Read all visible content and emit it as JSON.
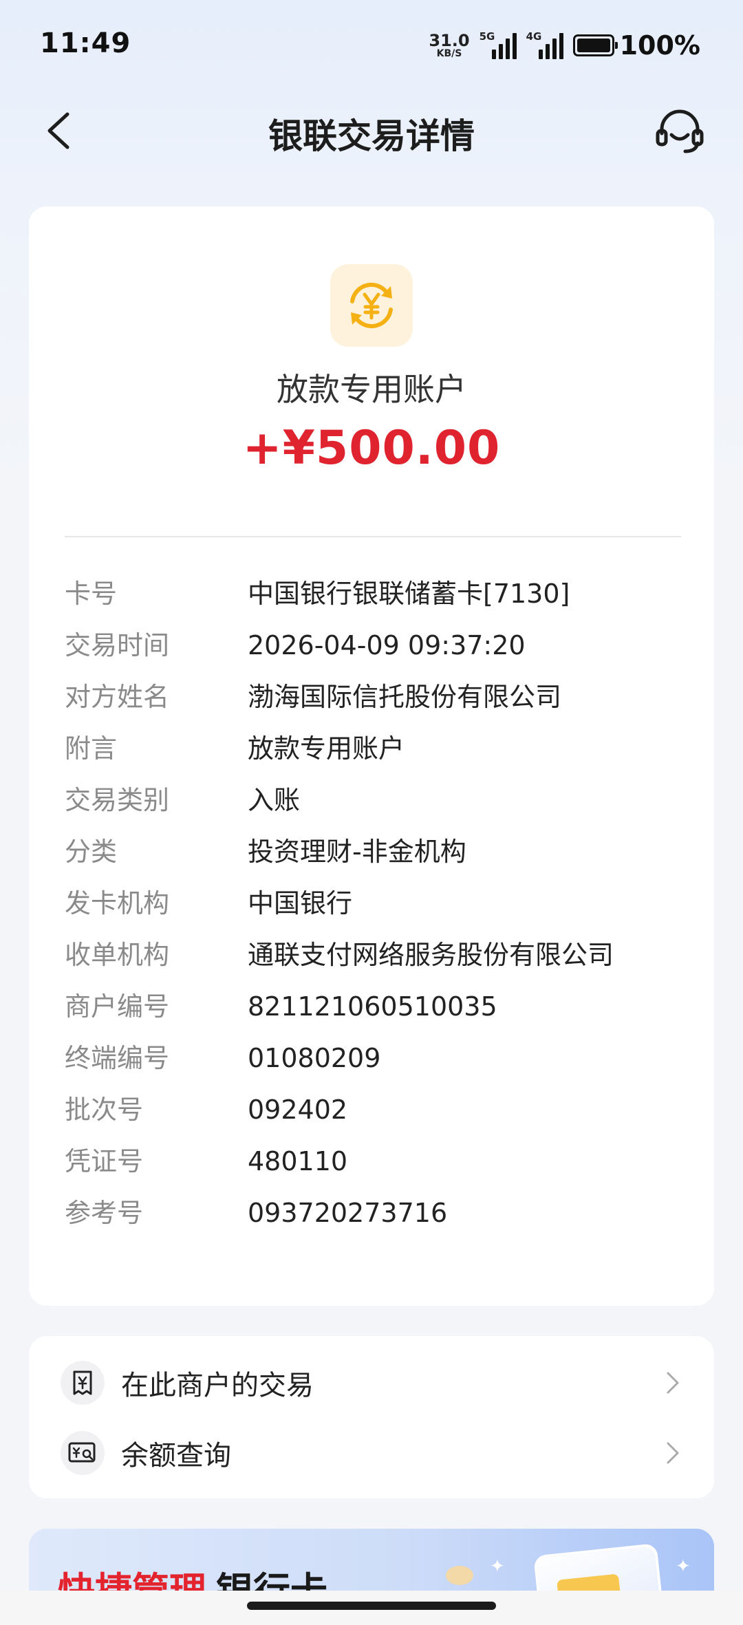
{
  "status_bar": {
    "time": "11:49",
    "network_speed": "31.0",
    "network_speed_unit": "KB/S",
    "sim1_tag": "5G",
    "sim2_tag": "4G",
    "battery": "100%"
  },
  "header": {
    "title": "银联交易详情",
    "back_icon": "chevron-left-icon",
    "service_icon": "headset-icon"
  },
  "transaction": {
    "icon": "yuan-exchange-icon",
    "account_name": "放款专用账户",
    "amount": "+¥500.00",
    "amount_color": "#e0242f",
    "details": [
      {
        "label": "卡号",
        "value": "中国银行银联储蓄卡[7130]"
      },
      {
        "label": "交易时间",
        "value": "2026-04-09 09:37:20"
      },
      {
        "label": "对方姓名",
        "value": "渤海国际信托股份有限公司"
      },
      {
        "label": "附言",
        "value": "放款专用账户"
      },
      {
        "label": "交易类别",
        "value": "入账"
      },
      {
        "label": "分类",
        "value": "投资理财-非金机构"
      },
      {
        "label": "发卡机构",
        "value": "中国银行"
      },
      {
        "label": "收单机构",
        "value": "通联支付网络服务股份有限公司"
      },
      {
        "label": "商户编号",
        "value": "821121060510035"
      },
      {
        "label": "终端编号",
        "value": "01080209"
      },
      {
        "label": "批次号",
        "value": "092402"
      },
      {
        "label": "凭证号",
        "value": "480110"
      },
      {
        "label": "参考号",
        "value": "093720273716"
      }
    ]
  },
  "actions": [
    {
      "icon": "receipt-yuan-icon",
      "label": "在此商户的交易"
    },
    {
      "icon": "balance-search-icon",
      "label": "余额查询"
    }
  ],
  "banner": {
    "highlight": "快捷管理",
    "text": "银行卡"
  }
}
